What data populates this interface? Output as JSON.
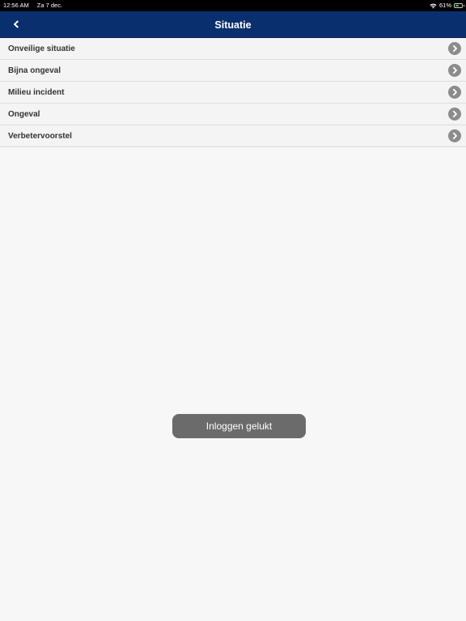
{
  "status_bar": {
    "time": "12:56 AM",
    "date": "Za 7 dec.",
    "battery": "61%",
    "battery_level": 0.61,
    "battery_color": "#39c93d"
  },
  "nav": {
    "title": "Situatie",
    "back_icon": "chevron-left-icon",
    "background_color": "#0a2f6e"
  },
  "situations": [
    {
      "label": "Onveilige situatie",
      "icon": "chevron-right-circle-icon"
    },
    {
      "label": "Bijna ongeval",
      "icon": "chevron-right-circle-icon"
    },
    {
      "label": "Milieu incident",
      "icon": "chevron-right-circle-icon"
    },
    {
      "label": "Ongeval",
      "icon": "chevron-right-circle-icon"
    },
    {
      "label": "Verbetervoorstel",
      "icon": "chevron-right-circle-icon"
    }
  ],
  "toast": {
    "message": "Inloggen gelukt"
  }
}
